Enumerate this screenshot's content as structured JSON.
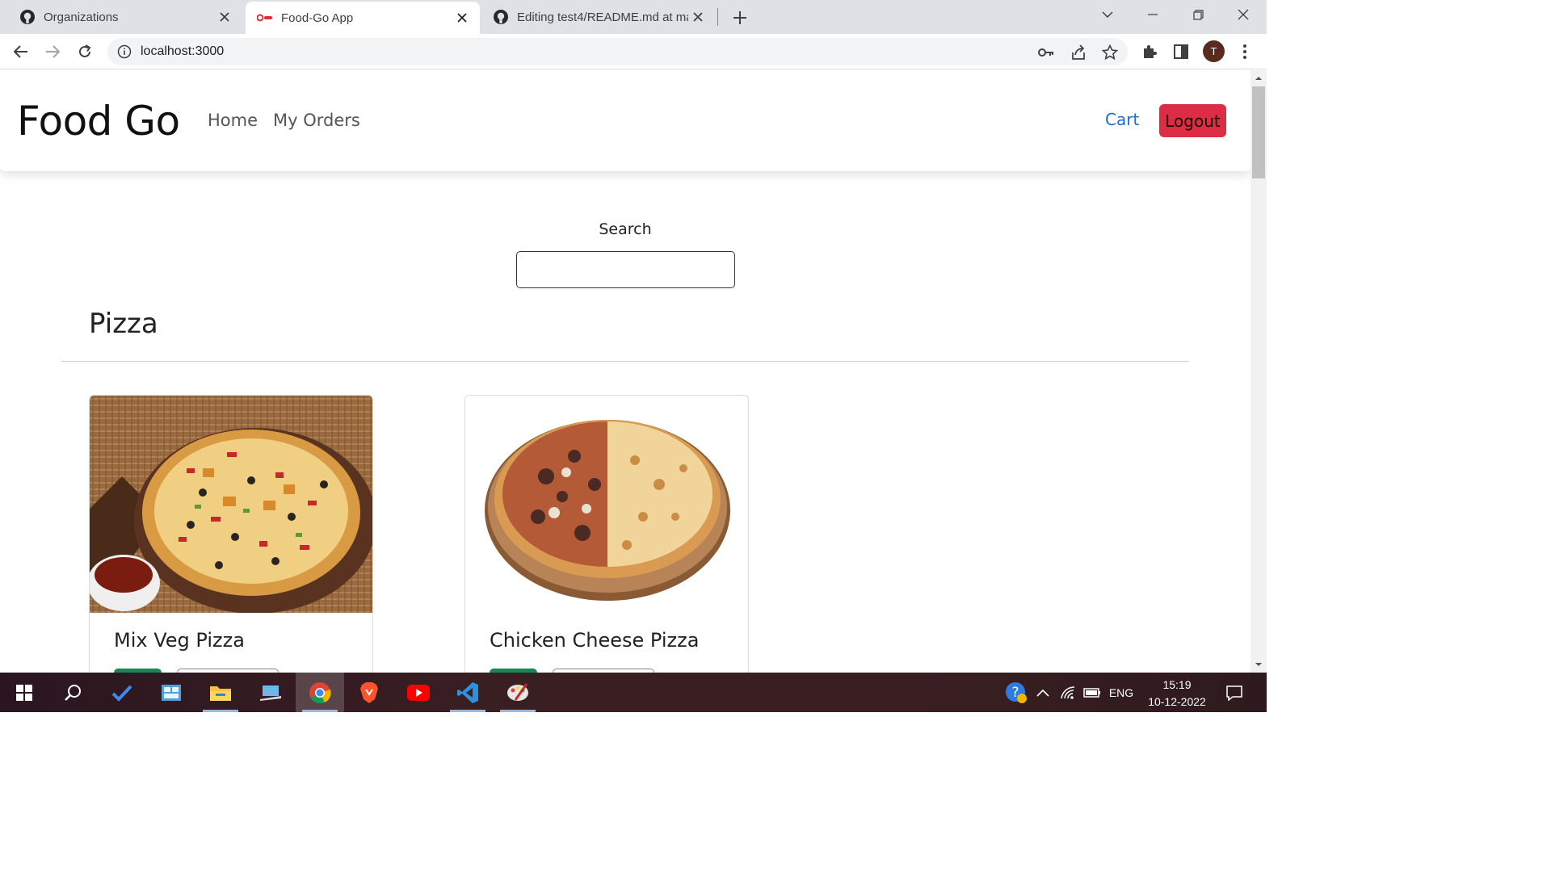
{
  "browser": {
    "tabs": [
      {
        "title": "Organizations",
        "active": false
      },
      {
        "title": "Food-Go App",
        "active": true
      },
      {
        "title": "Editing test4/README.md at mai",
        "active": false
      }
    ],
    "url": "localhost:3000",
    "profile_initial": "T"
  },
  "navbar": {
    "brand": "Food Go",
    "links": [
      "Home",
      "My Orders"
    ],
    "cart_label": "Cart",
    "logout_label": "Logout"
  },
  "search": {
    "label": "Search",
    "value": ""
  },
  "category": {
    "title": "Pizza",
    "items": [
      {
        "name": "Mix Veg Pizza"
      },
      {
        "name": "Chicken Cheese Pizza"
      }
    ]
  },
  "taskbar": {
    "language": "ENG",
    "time": "15:19",
    "date": "10-12-2022"
  },
  "colors": {
    "logout_bg": "#dc2d44",
    "cart_link": "#1a6cd8",
    "qty_button": "#198754"
  }
}
